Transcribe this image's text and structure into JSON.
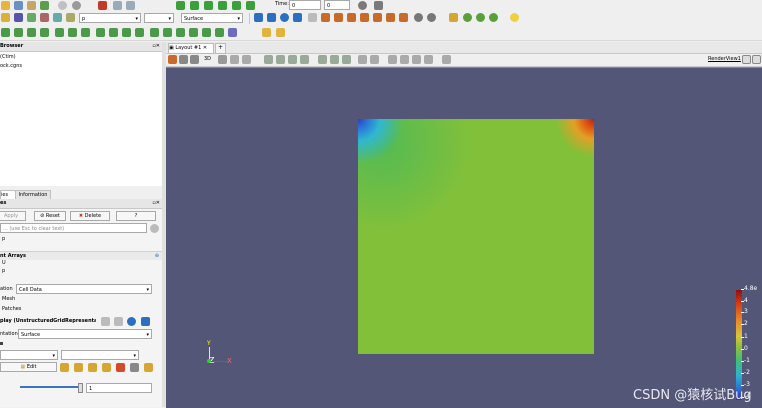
{
  "toolbar1": {
    "time_label": "Time:",
    "time_value": "0",
    "time_step": "0",
    "variable_combo": "p",
    "representation": "Surface"
  },
  "pipeline_browser": {
    "title": "Browser",
    "items": [
      "(Ctim)",
      "ock.cgns"
    ]
  },
  "tabs": {
    "properties": "ies",
    "information": "Information"
  },
  "properties": {
    "section_title": "es",
    "apply": "Apply",
    "reset": "Reset",
    "delete": "Delete",
    "help": "?",
    "search_placeholder": "... (use Esc to clear text)",
    "p_label": "p",
    "point_arrays_title": "nt Arrays",
    "arrays": [
      "U",
      "p"
    ],
    "location_label": "ation",
    "location_value": "Cell Data",
    "mesh": "Mesh",
    "patches": "Patches",
    "display_title": "play (UnstructuredGridRepresentati",
    "representation_label": "ntation",
    "representation_value": "Surface",
    "edit": "Edit",
    "opacity_value": "1"
  },
  "layout": {
    "tab_label": "Layout #1",
    "add_tab": "+",
    "view_name": "RenderView1",
    "view_3d": "3D"
  },
  "colorbar": {
    "ticks": [
      "4.8e",
      "4",
      "3",
      "2",
      "1",
      "0",
      "-1",
      "-2",
      "-3",
      "-4"
    ],
    "colors": [
      "#8a1010",
      "#e98a2a",
      "#90c03a",
      "#2fb3cf",
      "#3a2fb0"
    ]
  },
  "axes": {
    "y": "Y",
    "z": "Z",
    "x": "X"
  },
  "watermark": "CSDN @猿核试Bug",
  "colors": {
    "background": "#535677",
    "field": "#82c03a"
  }
}
